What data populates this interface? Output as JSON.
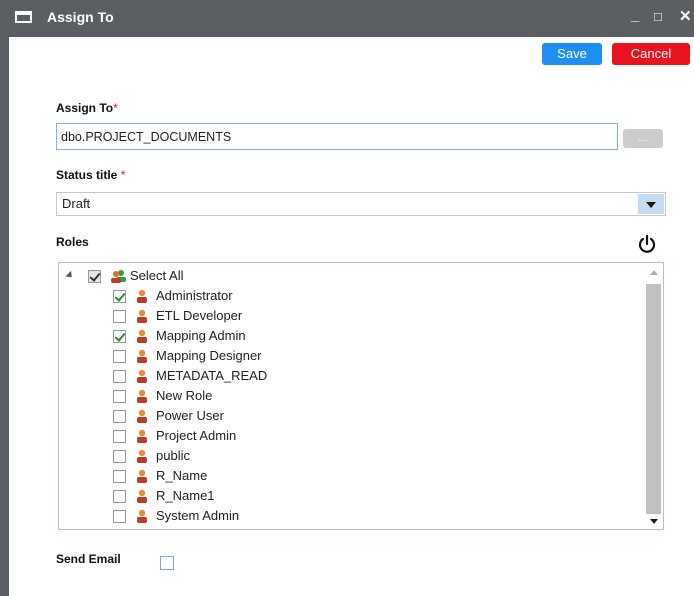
{
  "window": {
    "title": "Assign To",
    "min": "_",
    "max": "□",
    "close": "✕"
  },
  "toolbar": {
    "save_label": "Save",
    "cancel_label": "Cancel"
  },
  "assign_to": {
    "label": "Assign To",
    "required": "*",
    "value": "dbo.PROJECT_DOCUMENTS",
    "browse_label": "..."
  },
  "status": {
    "label": "Status title",
    "required": "*",
    "value": "Draft"
  },
  "roles": {
    "label": "Roles",
    "select_all": "Select All",
    "items": [
      {
        "label": "Administrator",
        "checked": true
      },
      {
        "label": "ETL Developer",
        "checked": false
      },
      {
        "label": "Mapping Admin",
        "checked": true
      },
      {
        "label": "Mapping Designer",
        "checked": false
      },
      {
        "label": "METADATA_READ",
        "checked": false
      },
      {
        "label": "New Role",
        "checked": false
      },
      {
        "label": "Power User",
        "checked": false
      },
      {
        "label": "Project Admin",
        "checked": false
      },
      {
        "label": "public",
        "checked": false
      },
      {
        "label": "R_Name",
        "checked": false
      },
      {
        "label": "R_Name1",
        "checked": false
      },
      {
        "label": "System Admin",
        "checked": false
      }
    ]
  },
  "send_email": {
    "label": "Send Email",
    "checked": false
  },
  "colors": {
    "save": "#1e8ff0",
    "cancel": "#e8131c",
    "titlebar": "#5b5f64",
    "check": "#2d8a2d"
  }
}
